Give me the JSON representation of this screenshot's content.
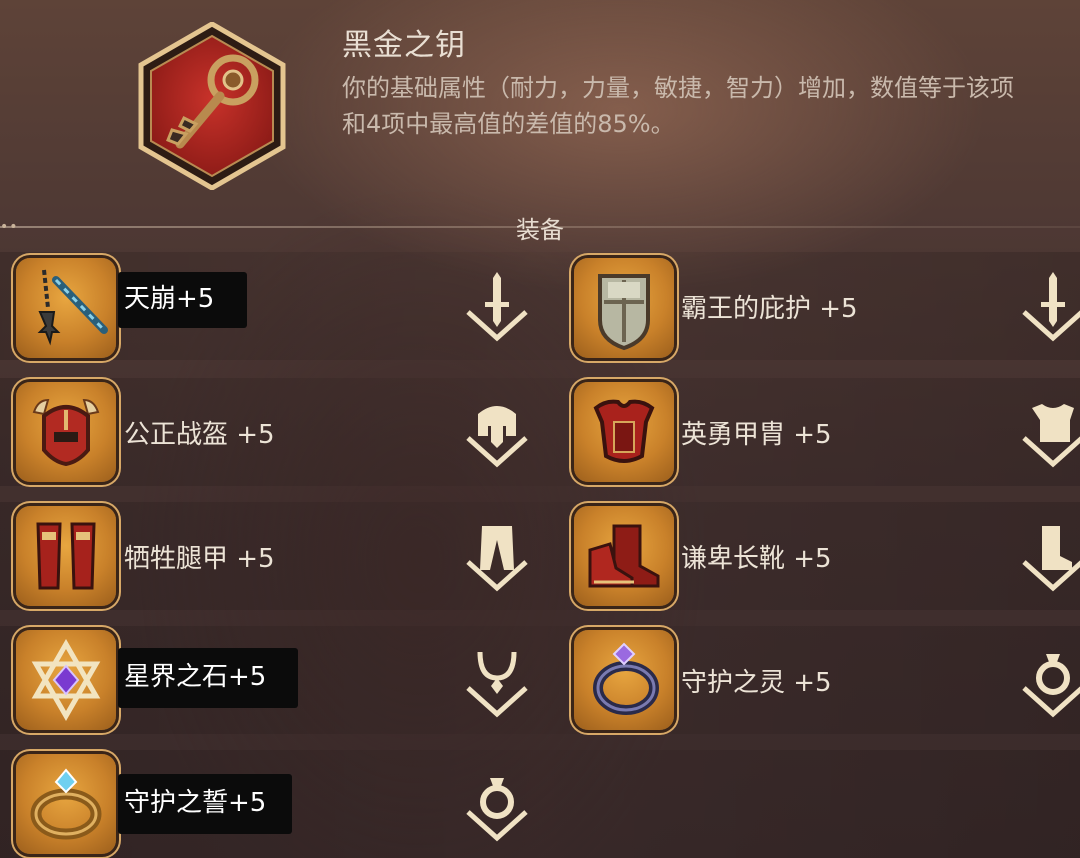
{
  "item": {
    "name": "黑金之钥",
    "description": "你的基础属性（耐力，力量，敏捷，智力）增加，数值等于该项和4项中最高值的差值的85%。",
    "icon": "ornate-key-icon"
  },
  "section": {
    "title": "装备",
    "dots": "••"
  },
  "equipment": [
    {
      "label": "天崩+5",
      "icon": "flail-icon",
      "type_icon": "sword-type-icon"
    },
    {
      "label": "霸王的庇护 +5",
      "icon": "shield-icon",
      "type_icon": "sword-type-icon"
    },
    {
      "label": "公正战盔 +5",
      "icon": "helmet-icon",
      "type_icon": "helmet-type-icon"
    },
    {
      "label": "英勇甲胄 +5",
      "icon": "armor-icon",
      "type_icon": "chest-type-icon"
    },
    {
      "label": "牺牲腿甲 +5",
      "icon": "greaves-icon",
      "type_icon": "pants-type-icon"
    },
    {
      "label": "谦卑长靴 +5",
      "icon": "boots-icon",
      "type_icon": "boot-type-icon"
    },
    {
      "label": "星界之石+5",
      "icon": "hexagram-gem-icon",
      "type_icon": "necklace-type-icon"
    },
    {
      "label": "守护之灵 +5",
      "icon": "dark-ring-icon",
      "type_icon": "ring-type-icon"
    },
    {
      "label": "守护之誓+5",
      "icon": "gem-ring-icon",
      "type_icon": "ring-type-icon"
    }
  ],
  "colors": {
    "slot_gold": "#c9812a",
    "text": "#ece3d6",
    "accent": "#d7a867"
  }
}
